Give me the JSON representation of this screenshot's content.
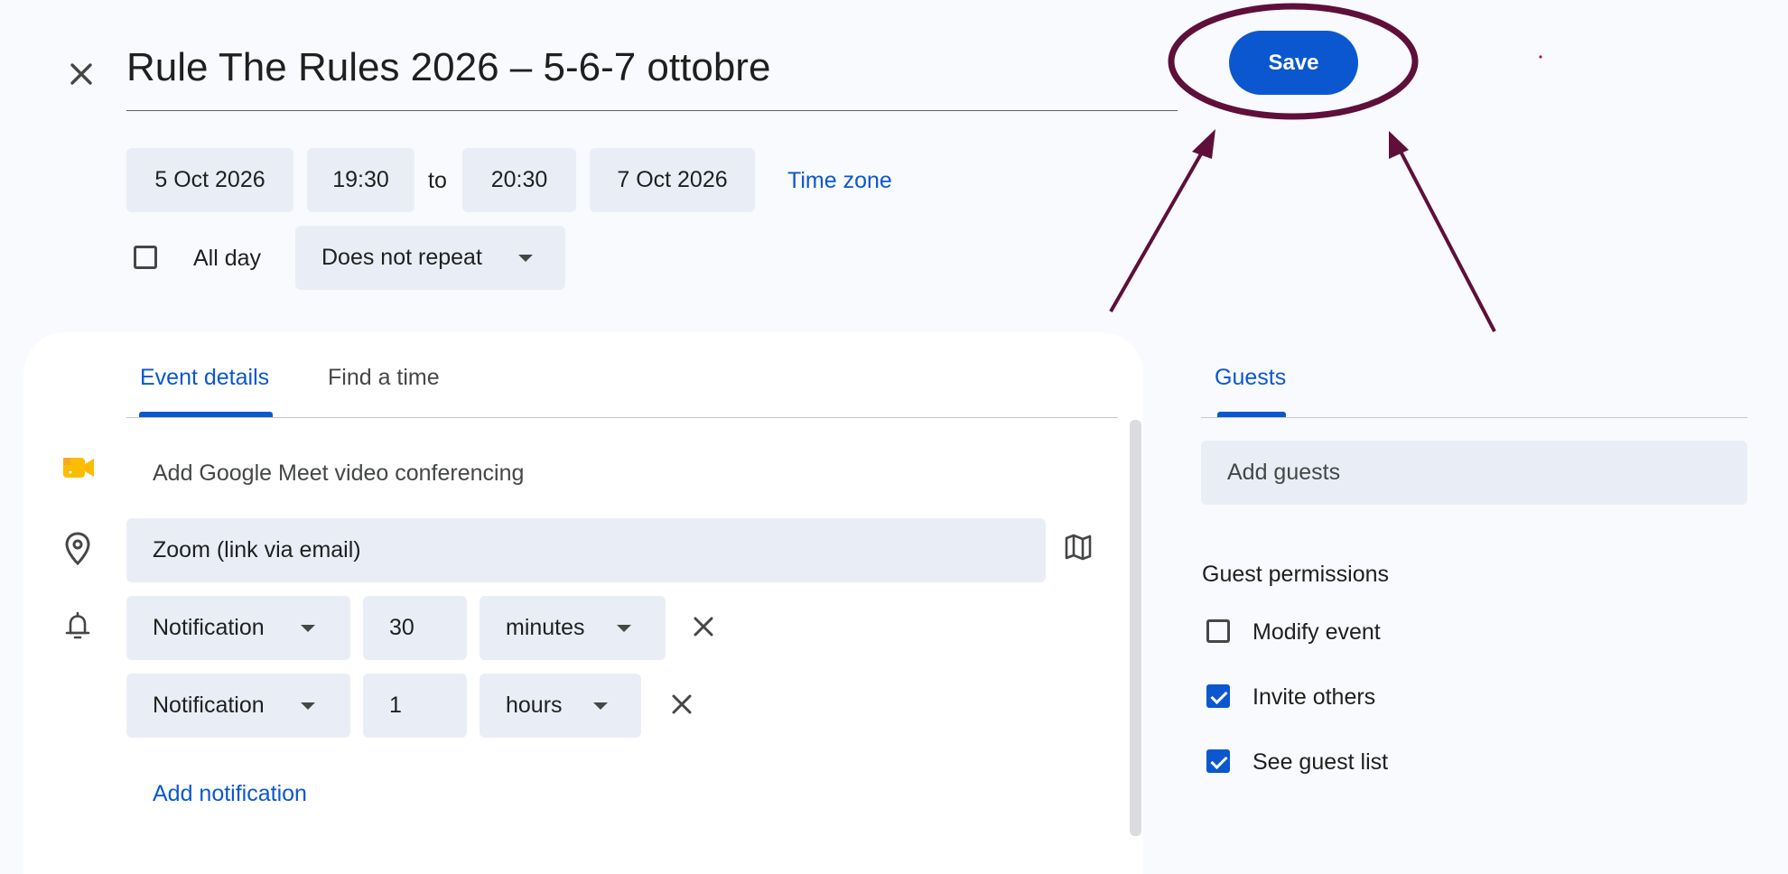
{
  "header": {
    "title": "Rule The Rules 2026 – 5-6-7 ottobre",
    "save_label": "Save"
  },
  "datetime": {
    "start_date": "5 Oct 2026",
    "start_time": "19:30",
    "to_label": "to",
    "end_time": "20:30",
    "end_date": "7 Oct 2026",
    "timezone_label": "Time zone",
    "all_day_label": "All day",
    "all_day_checked": false,
    "repeat_value": "Does not repeat"
  },
  "tabs": {
    "event_details": "Event details",
    "find_time": "Find a time",
    "active": "event_details"
  },
  "details": {
    "meet_label": "Add Google Meet video conferencing",
    "location_value": "Zoom (link via email)",
    "notifications": [
      {
        "type": "Notification",
        "amount": "30",
        "unit": "minutes"
      },
      {
        "type": "Notification",
        "amount": "1",
        "unit": "hours"
      }
    ],
    "add_notification_label": "Add notification"
  },
  "guests": {
    "tab_label": "Guests",
    "add_placeholder": "Add guests",
    "permissions_title": "Guest permissions",
    "permissions": [
      {
        "label": "Modify event",
        "checked": false
      },
      {
        "label": "Invite others",
        "checked": true
      },
      {
        "label": "See guest list",
        "checked": true
      }
    ]
  },
  "colors": {
    "accent": "#0b57d0",
    "annotation": "#5e0f3a",
    "field_bg": "#e9eef6",
    "page_bg": "#f8fafd"
  },
  "icons": [
    "close-icon",
    "video-camera-icon",
    "location-pin-icon",
    "map-icon",
    "bell-icon",
    "dropdown-arrow-icon",
    "remove-icon",
    "checkbox-icon"
  ]
}
